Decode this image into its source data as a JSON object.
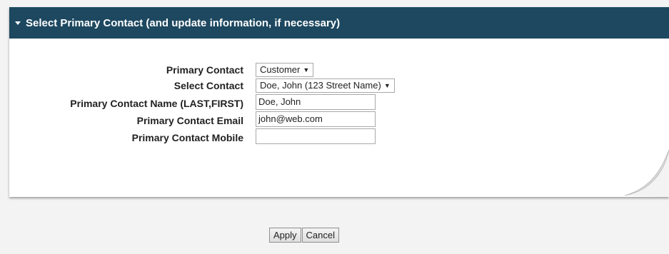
{
  "panel": {
    "title": "Select Primary Contact (and update information, if necessary)"
  },
  "form": {
    "primary_contact": {
      "label": "Primary Contact",
      "value": "Customer"
    },
    "select_contact": {
      "label": "Select Contact",
      "value": "Doe, John (123 Street Name)"
    },
    "contact_name": {
      "label": "Primary Contact Name (LAST,FIRST)",
      "value": "Doe, John"
    },
    "contact_email": {
      "label": "Primary Contact Email",
      "value": "john@web.com"
    },
    "contact_mobile": {
      "label": "Primary Contact Mobile",
      "value": ""
    }
  },
  "actions": {
    "apply_label": "Apply",
    "cancel_label": "Cancel"
  },
  "colors": {
    "header_bg": "#1d4860",
    "header_text": "#ffffff",
    "page_bg": "#f3f3f3"
  }
}
